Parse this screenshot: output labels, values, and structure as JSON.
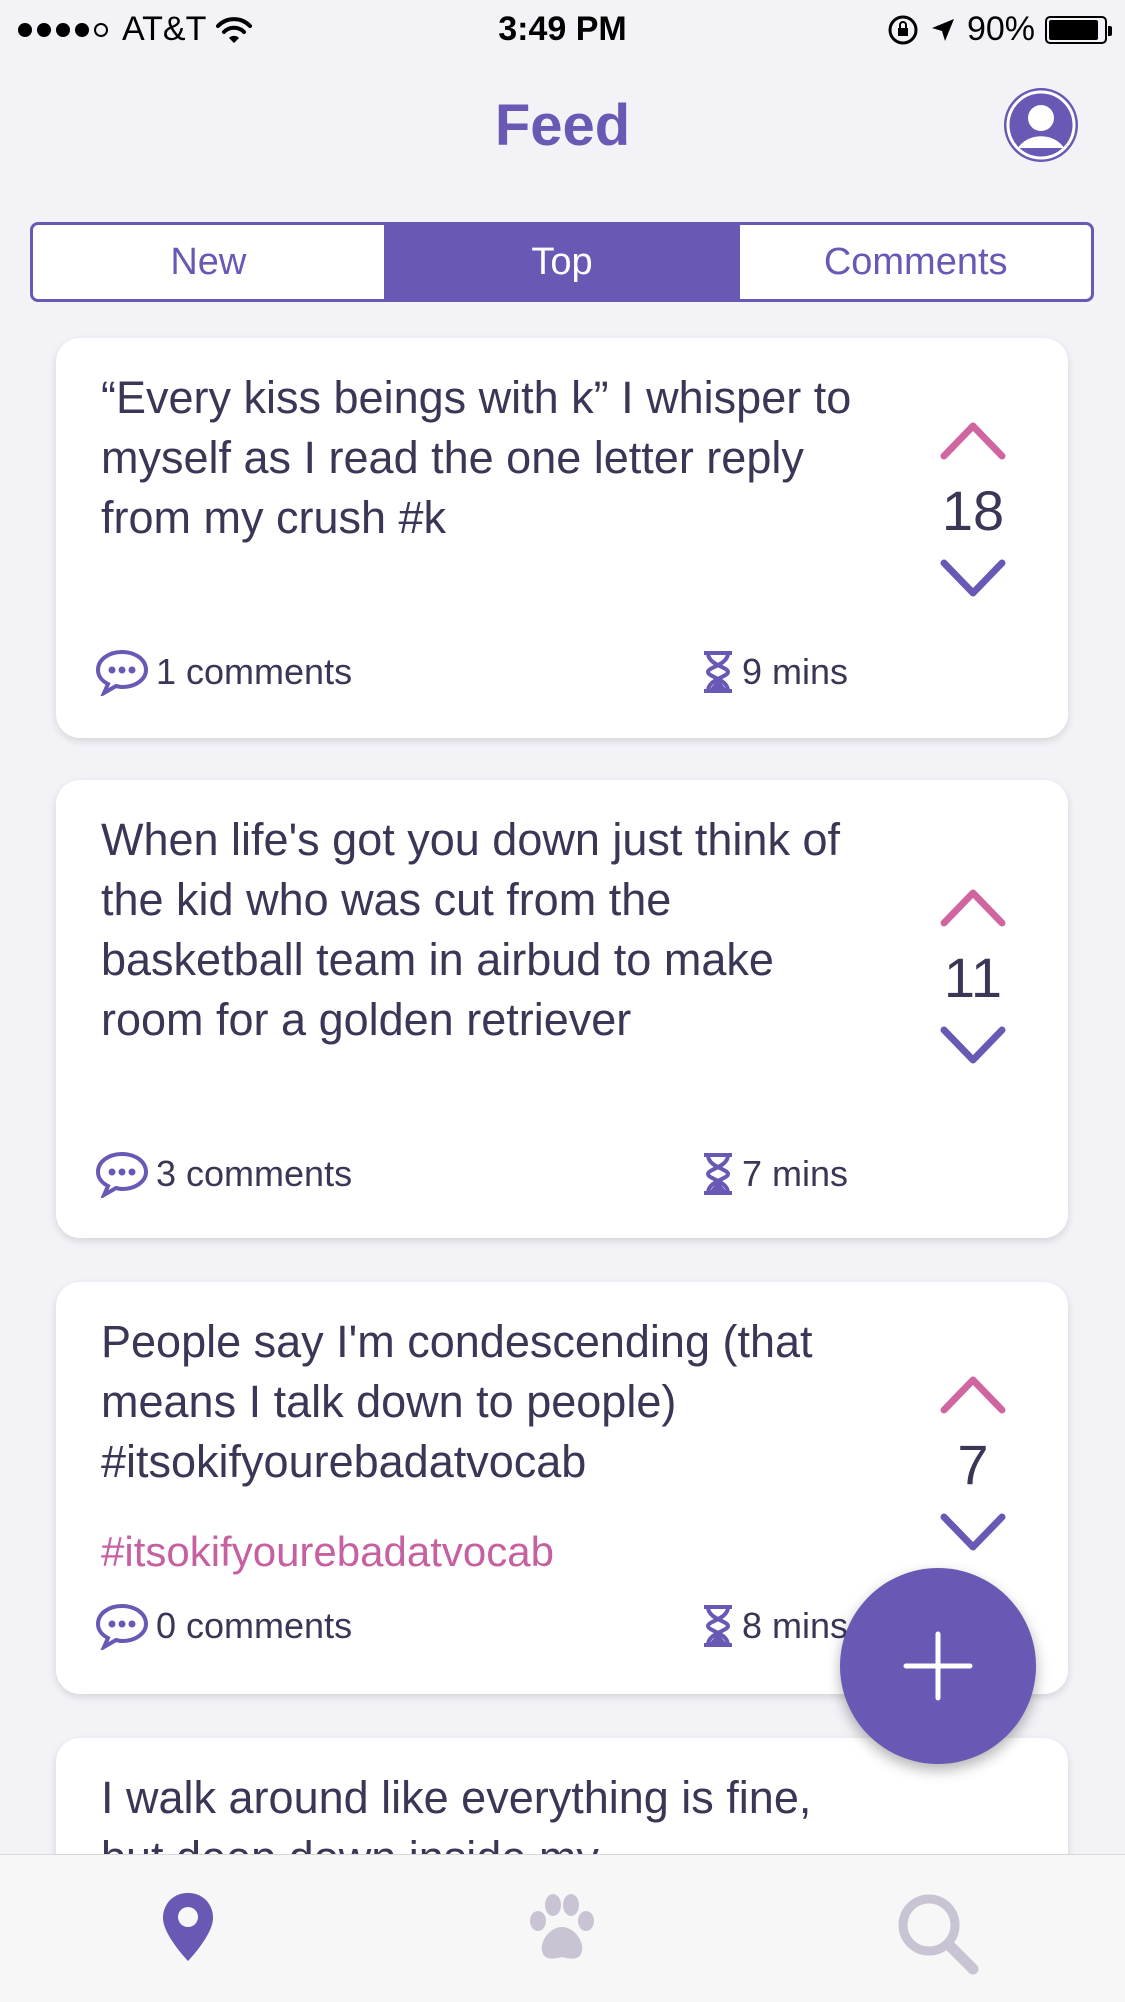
{
  "status_bar": {
    "carrier": "AT&T",
    "time": "3:49 PM",
    "battery": "90%"
  },
  "header": {
    "title": "Feed"
  },
  "segments": [
    {
      "label": "New",
      "active": false
    },
    {
      "label": "Top",
      "active": true
    },
    {
      "label": "Comments",
      "active": false
    }
  ],
  "posts": [
    {
      "text": "“Every kiss beings with k” I whisper to myself as I read the one letter reply from my crush #k",
      "score": "18",
      "comments": "1 comments",
      "time": "9 mins",
      "hashtag": ""
    },
    {
      "text": "When life's got you down just think of the kid who was cut from the basketball team in airbud to make room for a golden retriever",
      "score": "11",
      "comments": "3 comments",
      "time": "7 mins",
      "hashtag": ""
    },
    {
      "text": "People say I'm condescending (that means I talk down to people) #itsokifyourebadatvocab",
      "score": "7",
      "comments": "0 comments",
      "time": "8 mins",
      "hashtag": "#itsokifyourebadatvocab"
    },
    {
      "text": "I walk around like everything is fine, but deep down inside my"
    }
  ],
  "colors": {
    "accent": "#6a58b5",
    "upvote": "#d0669f",
    "text": "#3b3556",
    "hashtag": "#c660a0",
    "inactive_tab": "#c8c4d4"
  },
  "tabbar": [
    {
      "icon": "location-pin-icon",
      "active": true
    },
    {
      "icon": "paw-icon",
      "active": false
    },
    {
      "icon": "search-icon",
      "active": false
    }
  ]
}
